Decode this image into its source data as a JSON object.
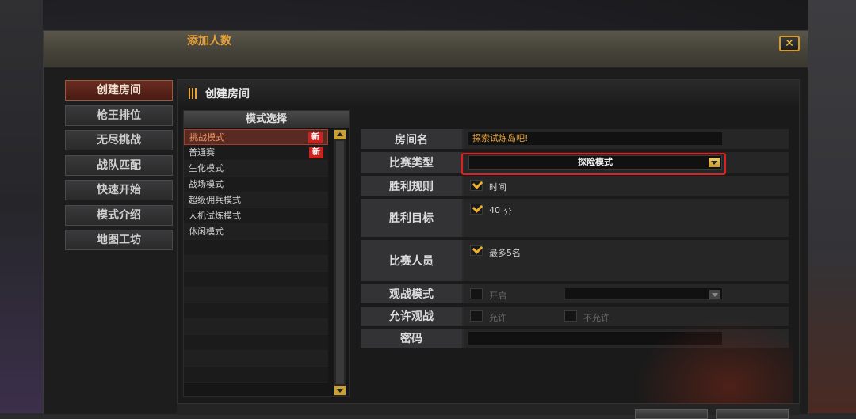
{
  "nav": {
    "items": [
      {
        "label": "创建房间",
        "active": true
      },
      {
        "label": "枪王排位",
        "active": false
      },
      {
        "label": "无尽挑战",
        "active": false
      },
      {
        "label": "战队匹配",
        "active": false
      },
      {
        "label": "快速开始",
        "active": false
      },
      {
        "label": "模式介绍",
        "active": false
      },
      {
        "label": "地图工坊",
        "active": false
      }
    ]
  },
  "panel": {
    "title": "创建房间"
  },
  "modes": {
    "header": "模式选择",
    "items": [
      {
        "label": "挑战模式",
        "badge": "新",
        "selected": true
      },
      {
        "label": "普通赛",
        "badge": "新",
        "selected": false
      },
      {
        "label": "生化模式",
        "badge": "",
        "selected": false
      },
      {
        "label": "战场模式",
        "badge": "",
        "selected": false
      },
      {
        "label": "超级佣兵模式",
        "badge": "",
        "selected": false
      },
      {
        "label": "人机试炼模式",
        "badge": "",
        "selected": false
      },
      {
        "label": "休闲模式",
        "badge": "",
        "selected": false
      }
    ]
  },
  "form": {
    "section_title": "添加人数",
    "room_name": {
      "label": "房间名",
      "value": "探索试炼岛吧!"
    },
    "match_type": {
      "label": "比赛类型",
      "value": "探险模式"
    },
    "win_rule": {
      "label": "胜利规则",
      "option": "时间",
      "checked": true
    },
    "win_target": {
      "label": "胜利目标",
      "value": "40",
      "unit": "分",
      "checked": true
    },
    "players": {
      "label": "比赛人员",
      "option": "最多5名",
      "checked": true
    },
    "spectate_mode": {
      "label": "观战模式",
      "option": "开启",
      "checked": false
    },
    "allow_spectate": {
      "label": "允许观战",
      "allow": "允许",
      "deny": "不允许"
    },
    "password": {
      "label": "密码",
      "value": ""
    }
  },
  "colors": {
    "accent": "#e8a23a",
    "highlight_border": "#e02020",
    "active_nav": "#5a2a22"
  }
}
